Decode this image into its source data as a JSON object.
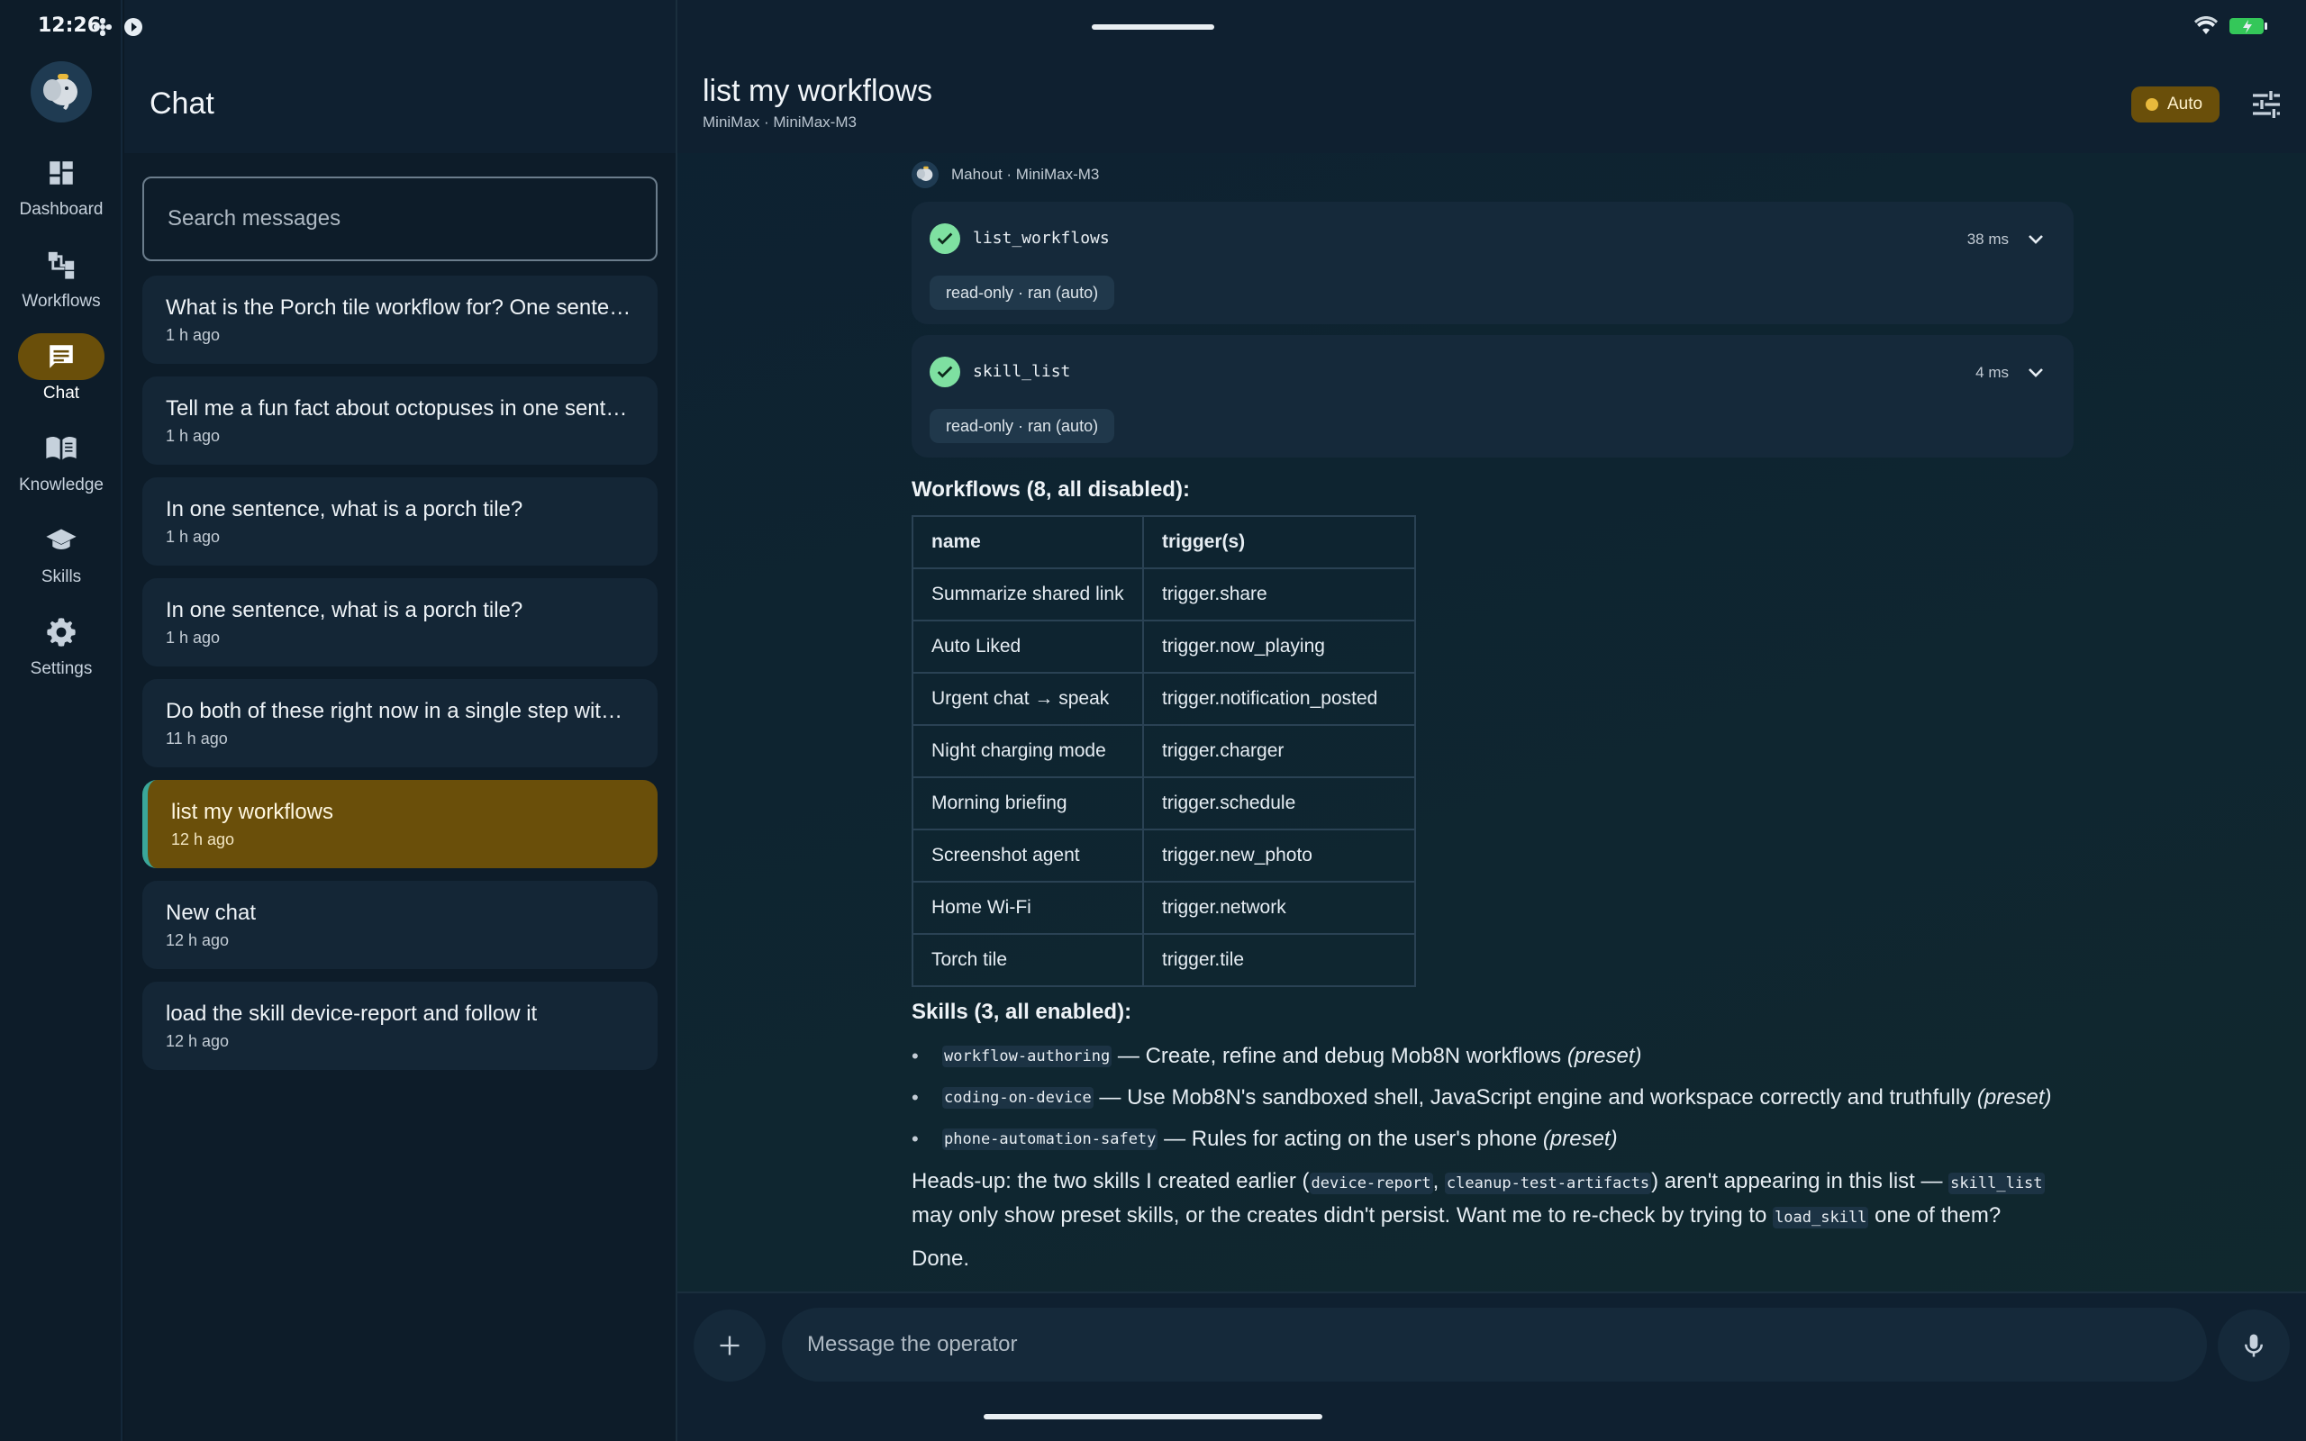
{
  "status": {
    "time": "12:26"
  },
  "rail": {
    "items": [
      {
        "label": "Dashboard",
        "icon": "dashboard-icon"
      },
      {
        "label": "Workflows",
        "icon": "workflow-icon"
      },
      {
        "label": "Chat",
        "icon": "chat-icon",
        "active": true
      },
      {
        "label": "Knowledge",
        "icon": "book-icon"
      },
      {
        "label": "Skills",
        "icon": "school-icon"
      },
      {
        "label": "Settings",
        "icon": "gear-icon"
      }
    ]
  },
  "list": {
    "title": "Chat",
    "search_placeholder": "Search messages",
    "conversations": [
      {
        "title": "What is the Porch tile workflow for? One sentence.",
        "time": "1 h ago"
      },
      {
        "title": "Tell me a fun fact about octopuses in one sentence.",
        "time": "1 h ago"
      },
      {
        "title": "In one sentence, what is a porch tile?",
        "time": "1 h ago"
      },
      {
        "title": "In one sentence, what is a porch tile?",
        "time": "1 h ago"
      },
      {
        "title": "Do both of these right now in a single step without asking.",
        "time": "11 h ago"
      },
      {
        "title": "list my workflows",
        "time": "12 h ago",
        "active": true
      },
      {
        "title": "New chat",
        "time": "12 h ago"
      },
      {
        "title": "load the skill device-report and follow it",
        "time": "12 h ago"
      }
    ]
  },
  "main": {
    "title": "list my workflows",
    "subtitle": "MiniMax · MiniMax-M3",
    "mode_badge": "Auto",
    "author": "Mahout · MiniMax-M3",
    "tools": [
      {
        "name": "list_workflows",
        "duration": "38 ms",
        "chip": "read-only · ran (auto)"
      },
      {
        "name": "skill_list",
        "duration": "4 ms",
        "chip": "read-only · ran (auto)"
      }
    ],
    "workflows_heading": "Workflows (8, all disabled):",
    "table_headers": [
      "name",
      "trigger(s)"
    ],
    "workflows": [
      [
        "Summarize shared link",
        "trigger.share"
      ],
      [
        "Auto Liked",
        "trigger.now_playing"
      ],
      [
        "Urgent chat → speak",
        "trigger.notification_posted"
      ],
      [
        "Night charging mode",
        "trigger.charger"
      ],
      [
        "Morning briefing",
        "trigger.schedule"
      ],
      [
        "Screenshot agent",
        "trigger.new_photo"
      ],
      [
        "Home Wi-Fi",
        "trigger.network"
      ],
      [
        "Torch tile",
        "trigger.tile"
      ]
    ],
    "skills_heading": "Skills (3, all enabled):",
    "skills": [
      {
        "code": "workflow-authoring",
        "desc": " — Create, refine and debug Mob8N workflows ",
        "tag": "(preset)"
      },
      {
        "code": "coding-on-device",
        "desc": " — Use Mob8N's sandboxed shell, JavaScript engine and workspace correctly and truthfully ",
        "tag": "(preset)"
      },
      {
        "code": "phone-automation-safety",
        "desc": " — Rules for acting on the user's phone ",
        "tag": "(preset)"
      }
    ],
    "headsup": {
      "t1": "Heads-up: the two skills I created earlier (",
      "c1": "device-report",
      "t2": ", ",
      "c2": "cleanup-test-artifacts",
      "t3": ") aren't appearing in this list — ",
      "c3": "skill_list",
      "t4": " may only show preset skills, or the creates didn't persist. Want me to re-check by trying to ",
      "c4": "load_skill",
      "t5": " one of them?"
    },
    "done": "Done.",
    "composer_placeholder": "Message the operator"
  }
}
